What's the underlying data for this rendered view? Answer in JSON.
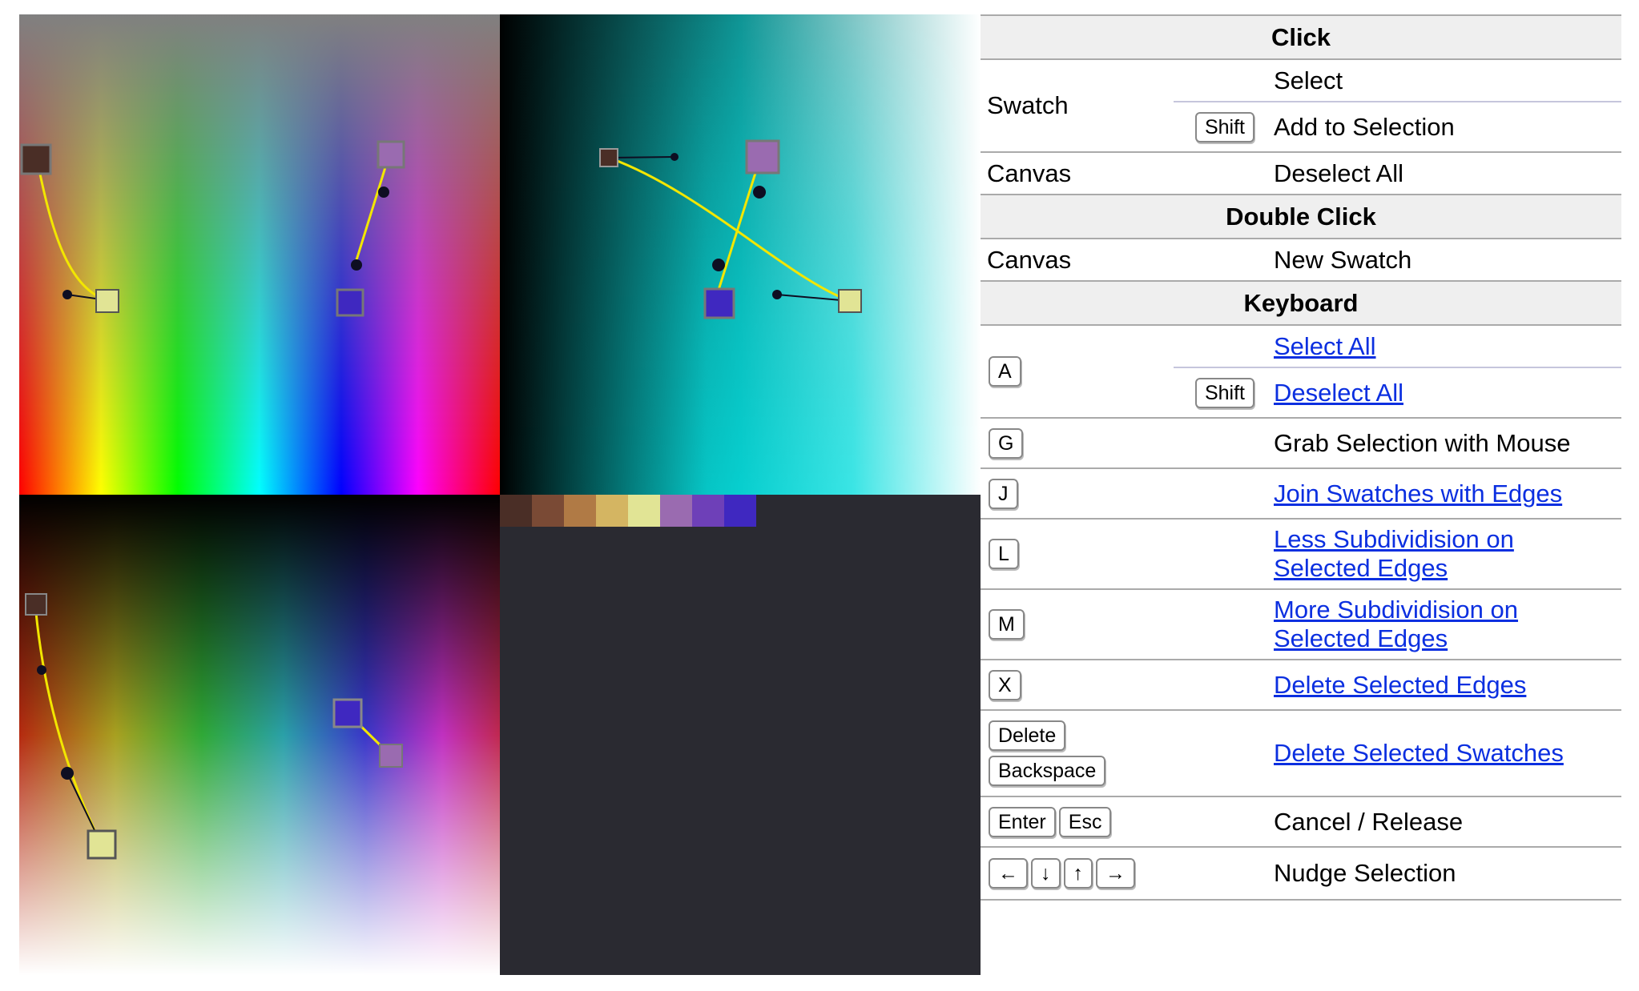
{
  "palette": [
    "#4a2e26",
    "#7a4a35",
    "#b07a45",
    "#d4b562",
    "#e1e495",
    "#9a6bb0",
    "#6e40b8",
    "#3f28c0"
  ],
  "accent": {
    "curve": "#f2e600",
    "handle": "#0e0e22",
    "panel_bg": "#2a2a31"
  },
  "help": {
    "click": {
      "title": "Click",
      "swatch_label": "Swatch",
      "select": "Select",
      "shift_key": "Shift",
      "add_to_selection": "Add to Selection",
      "canvas_label": "Canvas",
      "deselect_all": "Deselect All"
    },
    "double_click": {
      "title": "Double Click",
      "canvas_label": "Canvas",
      "new_swatch": "New Swatch"
    },
    "keyboard": {
      "title": "Keyboard",
      "key_a": "A",
      "select_all": "Select All",
      "shift_key": "Shift",
      "deselect_all": "Deselect All",
      "key_g": "G",
      "grab": "Grab Selection with Mouse",
      "key_j": "J",
      "join": "Join Swatches with Edges",
      "key_l": "L",
      "less": "Less Subdividision on Selected Edges",
      "key_m": "M",
      "more": "More Subdividision on Selected Edges",
      "key_x": "X",
      "delete_edges": "Delete Selected Edges",
      "key_delete": "Delete",
      "key_backspace": "Backspace",
      "delete_swatches": "Delete Selected Swatches",
      "key_enter": "Enter",
      "key_esc": "Esc",
      "cancel": "Cancel / Release",
      "key_left": "←",
      "key_down": "↓",
      "key_up": "↑",
      "key_right": "→",
      "nudge": "Nudge Selection"
    }
  }
}
